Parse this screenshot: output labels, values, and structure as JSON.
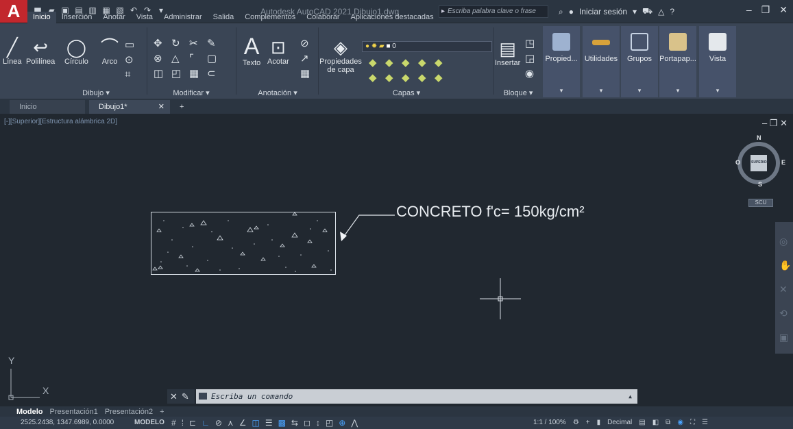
{
  "titlebar": {
    "app_logo": "A",
    "title": "Autodesk AutoCAD 2021   Dibujo1.dwg",
    "search_placeholder": "Escriba palabra clave o frase",
    "signin": "Iniciar sesión"
  },
  "ribbon_tabs": [
    "Inicio",
    "Inserción",
    "Anotar",
    "Vista",
    "Administrar",
    "Salida",
    "Complementos",
    "Colaborar",
    "Aplicaciones destacadas"
  ],
  "ribbon": {
    "dibujo": {
      "title": "Dibujo ▾",
      "tools": [
        "Línea",
        "Polilínea",
        "Círculo",
        "Arco"
      ]
    },
    "modificar": {
      "title": "Modificar ▾"
    },
    "anotacion": {
      "title": "Anotación ▾",
      "tools": [
        "Texto",
        "Acotar"
      ]
    },
    "capas": {
      "title": "Capas ▾",
      "tool": "Propiedades de capa",
      "layer_value": "0"
    },
    "bloque": {
      "title": "Bloque ▾",
      "tool": "Insertar"
    },
    "right_tools": [
      "Propied...",
      "Utilidades",
      "Grupos",
      "Portapap...",
      "Vista"
    ]
  },
  "doc_tabs": [
    "Inicio",
    "Dibujo1*"
  ],
  "canvas": {
    "viewport_label": "[-][Superior][Estructura alámbrica 2D]",
    "annotation": "CONCRETO f'c= 150kg/cm²",
    "compass": {
      "n": "N",
      "s": "S",
      "e": "E",
      "o": "O",
      "center": "SUPERIOR"
    },
    "ucs_label": "SCU",
    "axis_x": "X",
    "axis_y": "Y"
  },
  "command": {
    "placeholder": "Escriba un comando"
  },
  "layout_tabs": [
    "Modelo",
    "Presentación1",
    "Presentación2"
  ],
  "status": {
    "coords": "2525.2438, 1347.6989, 0.0000",
    "space": "MODELO",
    "scale": "1:1 / 100%",
    "units": "Decimal"
  },
  "colors": {
    "logo_red": "#c2272d",
    "canvas_bg": "#212830",
    "ribbon_bg": "#3a4555"
  }
}
